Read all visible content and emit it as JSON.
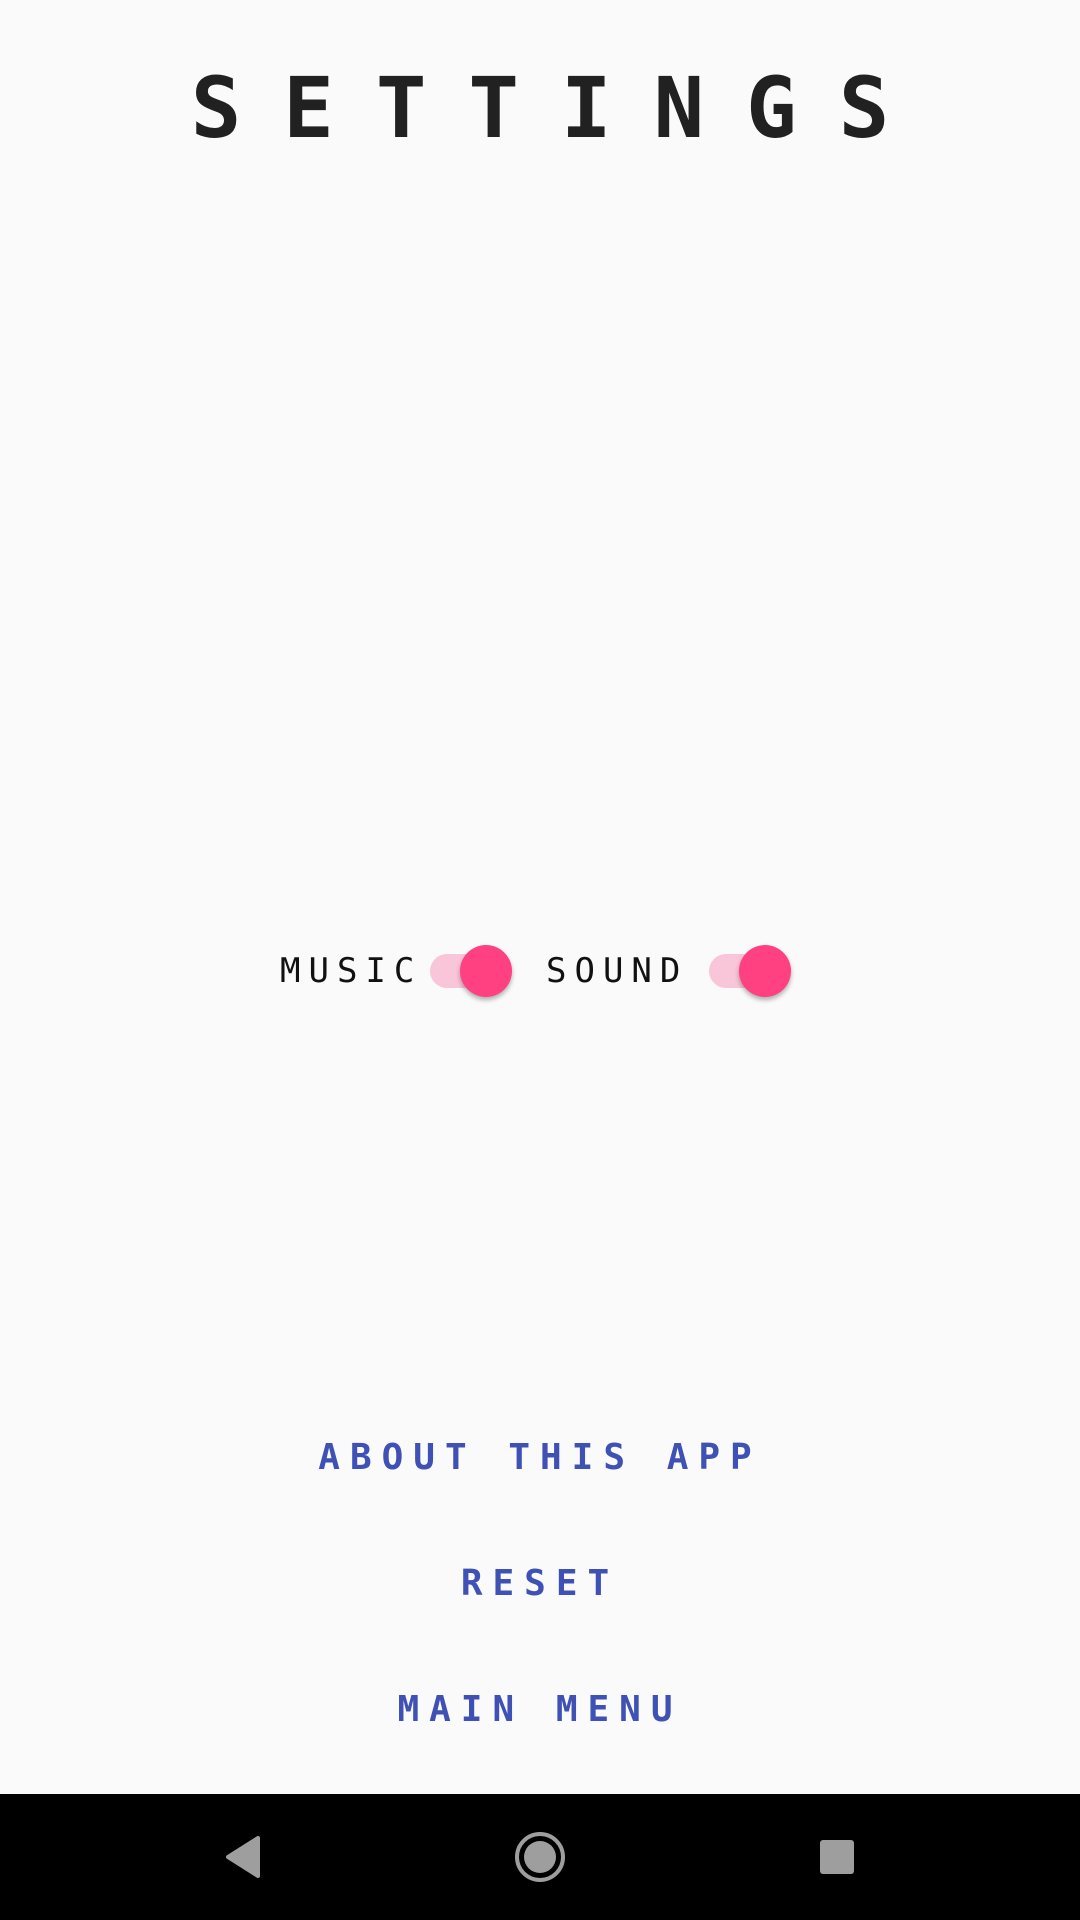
{
  "screen": {
    "title": "SETTINGS"
  },
  "toggles": {
    "music": {
      "label": "MUSIC",
      "on": true
    },
    "sound": {
      "label": "SOUND",
      "on": true
    }
  },
  "menu": {
    "about_label": "ABOUT THIS APP",
    "reset_label": "RESET",
    "main_menu_label": "MAIN MENU"
  },
  "colors": {
    "background": "#fafafa",
    "title_text": "#212121",
    "accent": "#ff4081",
    "accent_track": "#f8c6d8",
    "link": "#3f51b5",
    "nav_bar": "#000000"
  },
  "navbar": {
    "icons": [
      "back-icon",
      "home-icon",
      "recents-icon"
    ]
  }
}
